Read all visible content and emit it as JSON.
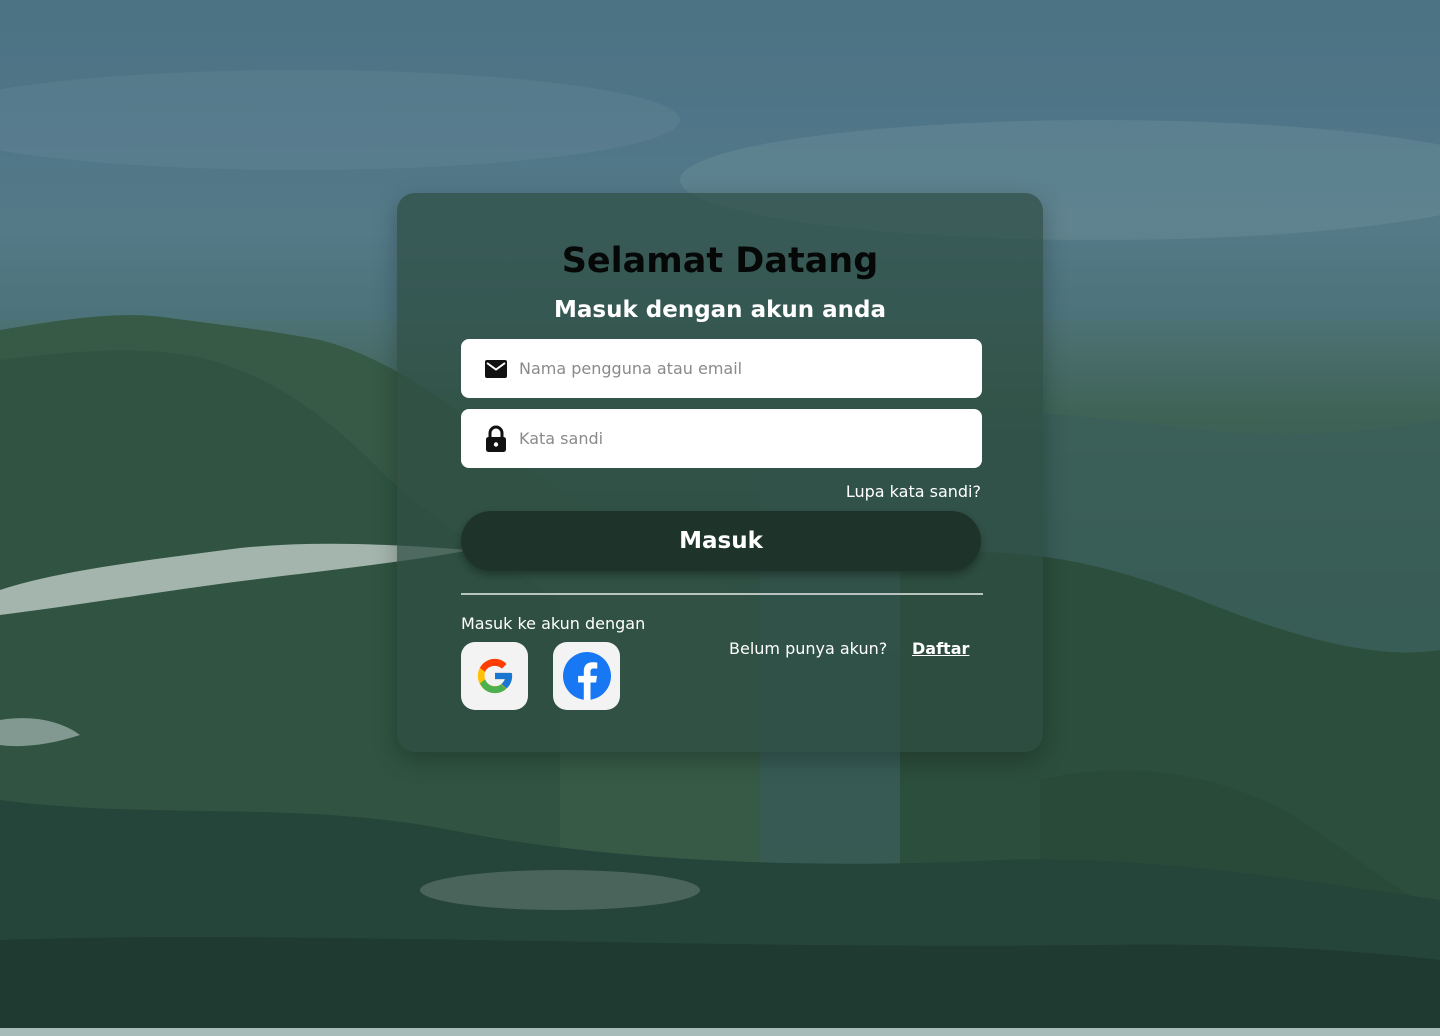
{
  "login": {
    "title": "Selamat Datang",
    "subtitle": "Masuk dengan akun anda",
    "email_placeholder": "Nama pengguna atau email",
    "password_placeholder": "Kata sandi",
    "forgot_link": "Lupa kata sandi?",
    "submit_label": "Masuk",
    "social_label": "Masuk ke akun dengan",
    "social_providers": [
      {
        "name": "google-icon"
      },
      {
        "name": "facebook-icon"
      }
    ],
    "no_account_text": "Belum punya akun?",
    "register_link": "Daftar"
  },
  "icons": {
    "email": "mail-icon",
    "password": "lock-icon"
  },
  "colors": {
    "button": "#1e342b",
    "card_overlay": "#2e4e42",
    "facebook": "#1877f2"
  }
}
